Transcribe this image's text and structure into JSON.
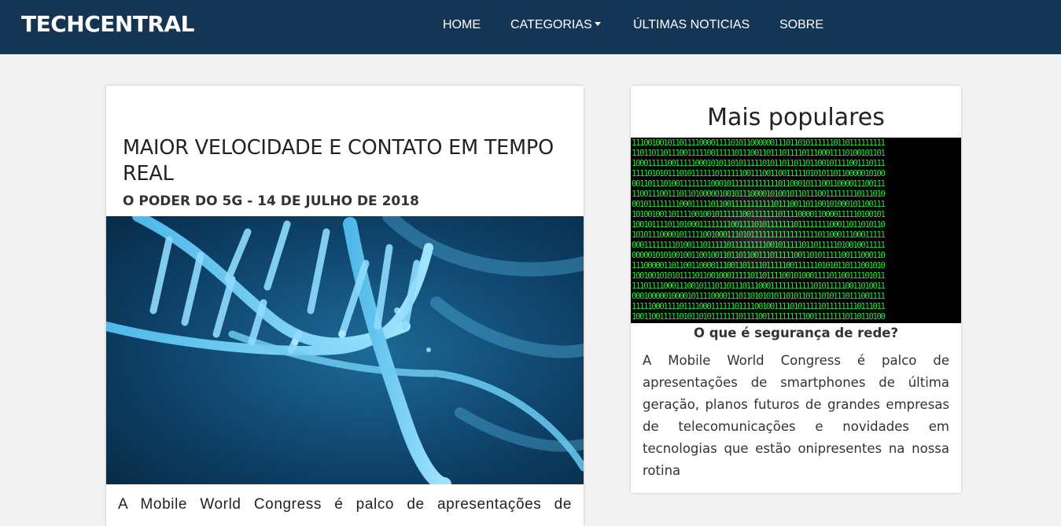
{
  "navbar": {
    "brand": "TECHCENTRAL",
    "links": {
      "home": "HOME",
      "categories": "CATEGORIAS",
      "latest": "ÚLTIMAS NOTICIAS",
      "about": "SOBRE"
    }
  },
  "main_article": {
    "title": "MAIOR VELOCIDADE E CONTATO EM TEMPO REAL",
    "subtitle": "O PODER DO 5G - 14 DE JULHO DE 2018",
    "image": "dna-helix-image",
    "text": "A Mobile World Congress é palco de apresentações de"
  },
  "sidebar": {
    "heading": "Mais populares",
    "image": "binary-code-image",
    "article_title": "O que é segurança de rede?",
    "article_text": "A Mobile World Congress é palco de apresentações de smartphones de última geração, planos futuros de grandes empresas de telecomunicações e novidades em tecnologias que estão onipresentes na nossa rotina"
  },
  "colors": {
    "navbar_bg": "#143554",
    "page_bg": "#f2f2f2",
    "binary_green": "#29e03a"
  }
}
